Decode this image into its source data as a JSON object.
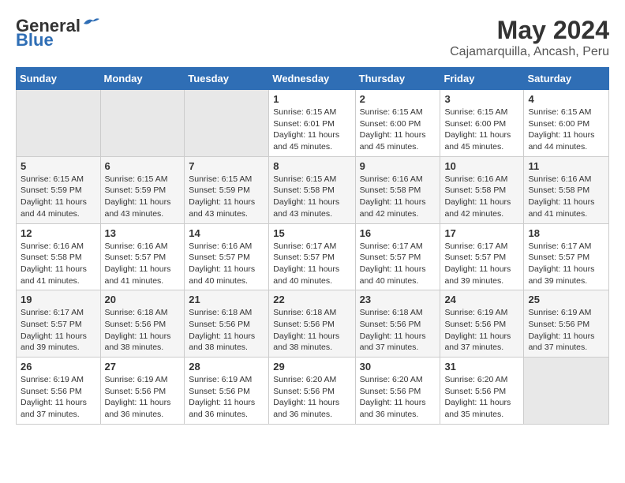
{
  "header": {
    "logo_general": "General",
    "logo_blue": "Blue",
    "title": "May 2024",
    "subtitle": "Cajamarquilla, Ancash, Peru"
  },
  "calendar": {
    "days_of_week": [
      "Sunday",
      "Monday",
      "Tuesday",
      "Wednesday",
      "Thursday",
      "Friday",
      "Saturday"
    ],
    "weeks": [
      [
        {
          "day": "",
          "info": ""
        },
        {
          "day": "",
          "info": ""
        },
        {
          "day": "",
          "info": ""
        },
        {
          "day": "1",
          "info": "Sunrise: 6:15 AM\nSunset: 6:01 PM\nDaylight: 11 hours and 45 minutes."
        },
        {
          "day": "2",
          "info": "Sunrise: 6:15 AM\nSunset: 6:00 PM\nDaylight: 11 hours and 45 minutes."
        },
        {
          "day": "3",
          "info": "Sunrise: 6:15 AM\nSunset: 6:00 PM\nDaylight: 11 hours and 45 minutes."
        },
        {
          "day": "4",
          "info": "Sunrise: 6:15 AM\nSunset: 6:00 PM\nDaylight: 11 hours and 44 minutes."
        }
      ],
      [
        {
          "day": "5",
          "info": "Sunrise: 6:15 AM\nSunset: 5:59 PM\nDaylight: 11 hours and 44 minutes."
        },
        {
          "day": "6",
          "info": "Sunrise: 6:15 AM\nSunset: 5:59 PM\nDaylight: 11 hours and 43 minutes."
        },
        {
          "day": "7",
          "info": "Sunrise: 6:15 AM\nSunset: 5:59 PM\nDaylight: 11 hours and 43 minutes."
        },
        {
          "day": "8",
          "info": "Sunrise: 6:15 AM\nSunset: 5:58 PM\nDaylight: 11 hours and 43 minutes."
        },
        {
          "day": "9",
          "info": "Sunrise: 6:16 AM\nSunset: 5:58 PM\nDaylight: 11 hours and 42 minutes."
        },
        {
          "day": "10",
          "info": "Sunrise: 6:16 AM\nSunset: 5:58 PM\nDaylight: 11 hours and 42 minutes."
        },
        {
          "day": "11",
          "info": "Sunrise: 6:16 AM\nSunset: 5:58 PM\nDaylight: 11 hours and 41 minutes."
        }
      ],
      [
        {
          "day": "12",
          "info": "Sunrise: 6:16 AM\nSunset: 5:58 PM\nDaylight: 11 hours and 41 minutes."
        },
        {
          "day": "13",
          "info": "Sunrise: 6:16 AM\nSunset: 5:57 PM\nDaylight: 11 hours and 41 minutes."
        },
        {
          "day": "14",
          "info": "Sunrise: 6:16 AM\nSunset: 5:57 PM\nDaylight: 11 hours and 40 minutes."
        },
        {
          "day": "15",
          "info": "Sunrise: 6:17 AM\nSunset: 5:57 PM\nDaylight: 11 hours and 40 minutes."
        },
        {
          "day": "16",
          "info": "Sunrise: 6:17 AM\nSunset: 5:57 PM\nDaylight: 11 hours and 40 minutes."
        },
        {
          "day": "17",
          "info": "Sunrise: 6:17 AM\nSunset: 5:57 PM\nDaylight: 11 hours and 39 minutes."
        },
        {
          "day": "18",
          "info": "Sunrise: 6:17 AM\nSunset: 5:57 PM\nDaylight: 11 hours and 39 minutes."
        }
      ],
      [
        {
          "day": "19",
          "info": "Sunrise: 6:17 AM\nSunset: 5:57 PM\nDaylight: 11 hours and 39 minutes."
        },
        {
          "day": "20",
          "info": "Sunrise: 6:18 AM\nSunset: 5:56 PM\nDaylight: 11 hours and 38 minutes."
        },
        {
          "day": "21",
          "info": "Sunrise: 6:18 AM\nSunset: 5:56 PM\nDaylight: 11 hours and 38 minutes."
        },
        {
          "day": "22",
          "info": "Sunrise: 6:18 AM\nSunset: 5:56 PM\nDaylight: 11 hours and 38 minutes."
        },
        {
          "day": "23",
          "info": "Sunrise: 6:18 AM\nSunset: 5:56 PM\nDaylight: 11 hours and 37 minutes."
        },
        {
          "day": "24",
          "info": "Sunrise: 6:19 AM\nSunset: 5:56 PM\nDaylight: 11 hours and 37 minutes."
        },
        {
          "day": "25",
          "info": "Sunrise: 6:19 AM\nSunset: 5:56 PM\nDaylight: 11 hours and 37 minutes."
        }
      ],
      [
        {
          "day": "26",
          "info": "Sunrise: 6:19 AM\nSunset: 5:56 PM\nDaylight: 11 hours and 37 minutes."
        },
        {
          "day": "27",
          "info": "Sunrise: 6:19 AM\nSunset: 5:56 PM\nDaylight: 11 hours and 36 minutes."
        },
        {
          "day": "28",
          "info": "Sunrise: 6:19 AM\nSunset: 5:56 PM\nDaylight: 11 hours and 36 minutes."
        },
        {
          "day": "29",
          "info": "Sunrise: 6:20 AM\nSunset: 5:56 PM\nDaylight: 11 hours and 36 minutes."
        },
        {
          "day": "30",
          "info": "Sunrise: 6:20 AM\nSunset: 5:56 PM\nDaylight: 11 hours and 36 minutes."
        },
        {
          "day": "31",
          "info": "Sunrise: 6:20 AM\nSunset: 5:56 PM\nDaylight: 11 hours and 35 minutes."
        },
        {
          "day": "",
          "info": ""
        }
      ]
    ]
  }
}
